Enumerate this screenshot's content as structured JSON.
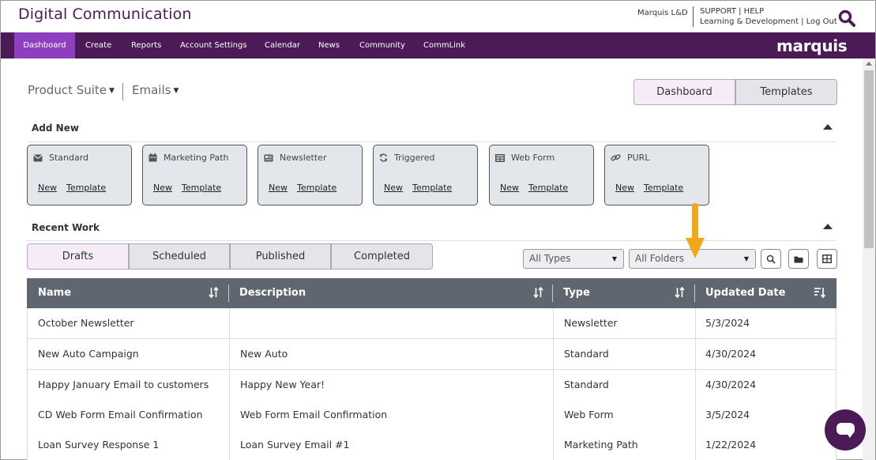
{
  "header": {
    "app_title": "Digital Communication",
    "org_name": "Marquis L&D",
    "support": "SUPPORT",
    "help": "HELP",
    "learning": "Learning & Development",
    "logout": "Log Out",
    "brand": "marquis"
  },
  "nav": {
    "items": [
      "Dashboard",
      "Create",
      "Reports",
      "Account Settings",
      "Calendar",
      "News",
      "Community",
      "CommLink"
    ],
    "active": "Dashboard"
  },
  "context": {
    "product_suite": "Product Suite",
    "emails": "Emails"
  },
  "view_toggle": {
    "dashboard": "Dashboard",
    "templates": "Templates",
    "active": "Dashboard"
  },
  "add_new": {
    "title": "Add New",
    "new_label": "New",
    "template_label": "Template",
    "cards": [
      {
        "label": "Standard",
        "icon": "envelope-icon"
      },
      {
        "label": "Marketing Path",
        "icon": "calendar-icon"
      },
      {
        "label": "Newsletter",
        "icon": "newspaper-icon"
      },
      {
        "label": "Triggered",
        "icon": "refresh-icon"
      },
      {
        "label": "Web Form",
        "icon": "table-icon"
      },
      {
        "label": "PURL",
        "icon": "link-icon"
      }
    ]
  },
  "recent_work": {
    "title": "Recent Work",
    "tabs": [
      "Drafts",
      "Scheduled",
      "Published",
      "Completed"
    ],
    "active_tab": "Drafts",
    "type_filter": "All Types",
    "folder_filter": "All Folders"
  },
  "table": {
    "columns": [
      "Name",
      "Description",
      "Type",
      "Updated Date"
    ],
    "rows": [
      {
        "name": "October Newsletter",
        "description": "",
        "type": "Newsletter",
        "date": "5/3/2024"
      },
      {
        "name": "New Auto Campaign",
        "description": "New Auto",
        "type": "Standard",
        "date": "4/30/2024"
      },
      {
        "name": "Happy January Email to customers",
        "description": "Happy New Year!",
        "type": "Standard",
        "date": "4/30/2024"
      },
      {
        "name": "CD Web Form Email Confirmation",
        "description": "Web Form Email Confirmation",
        "type": "Web Form",
        "date": "3/5/2024"
      },
      {
        "name": "Loan Survey Response 1",
        "description": "Loan Survey Email #1",
        "type": "Marketing Path",
        "date": "1/22/2024"
      }
    ]
  },
  "colors": {
    "brand_purple": "#4b1a57",
    "nav_active": "#8d3fbf",
    "table_header": "#5f6670",
    "annotation_arrow": "#f2a71b"
  }
}
